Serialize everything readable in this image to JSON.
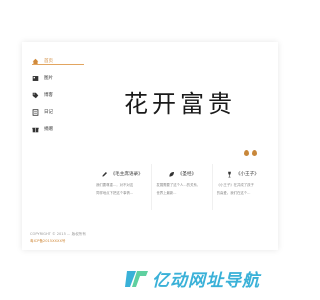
{
  "nav": {
    "items": [
      {
        "label": "首页",
        "icon": "home-icon",
        "active": true
      },
      {
        "label": "图片",
        "icon": "image-icon",
        "active": false
      },
      {
        "label": "博客",
        "icon": "tag-icon",
        "active": false
      },
      {
        "label": "日记",
        "icon": "note-icon",
        "active": false
      },
      {
        "label": "捐赠",
        "icon": "gift-icon",
        "active": false
      }
    ]
  },
  "brand": {
    "title": "花开富贵"
  },
  "cards": [
    {
      "title": "《毛主席语录》",
      "desc": [
        "我们要尊重...，对不对这",
        "同样地点下把这个事情..."
      ],
      "icon": "pen-icon"
    },
    {
      "title": "《圣经》",
      "desc": [
        "发展需要了这个人...的关系，",
        "世界上最新..."
      ],
      "icon": "leaf-icon"
    },
    {
      "title": "《小王子》",
      "desc": [
        "《小王子》在并成了孩子",
        "的喜爱。我们在这个..."
      ],
      "icon": "wine-icon"
    }
  ],
  "footer": {
    "copyright": "COPYRIGHT © 2015 ... 版权所有",
    "icp": "粤ICP备2015XXXX号"
  },
  "watermark": {
    "text": "亿动网址导航"
  },
  "colors": {
    "accent": "#d08a3c",
    "underline": "#e2a560",
    "watermark": "#3ab1d8"
  }
}
